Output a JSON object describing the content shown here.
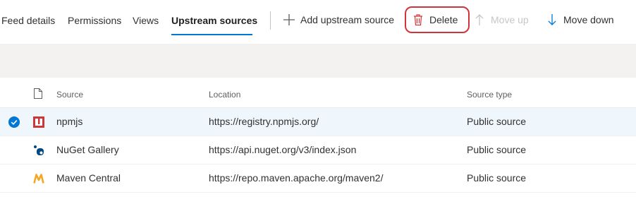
{
  "tabs": [
    {
      "label": "Feed details",
      "active": false
    },
    {
      "label": "Permissions",
      "active": false
    },
    {
      "label": "Views",
      "active": false
    },
    {
      "label": "Upstream sources",
      "active": true
    }
  ],
  "toolbar": {
    "add_label": "Add upstream source",
    "delete_label": "Delete",
    "move_up_label": "Move up",
    "move_up_disabled": true,
    "move_down_label": "Move down"
  },
  "table": {
    "columns": [
      "Source",
      "Location",
      "Source type"
    ],
    "rows": [
      {
        "name": "npmjs",
        "location": "https://registry.npmjs.org/",
        "type": "Public source",
        "icon": "npm-icon",
        "selected": true
      },
      {
        "name": "NuGet Gallery",
        "location": "https://api.nuget.org/v3/index.json",
        "type": "Public source",
        "icon": "nuget-icon",
        "selected": false
      },
      {
        "name": "Maven Central",
        "location": "https://repo.maven.apache.org/maven2/",
        "type": "Public source",
        "icon": "maven-icon",
        "selected": false
      }
    ]
  },
  "colors": {
    "accent": "#0078d4",
    "delete_icon": "#d13438",
    "highlight_outline": "#d13438",
    "selected_row": "#eff6fc",
    "npm_red": "#cb3837",
    "nuget_blue": "#004880",
    "maven_orange": "#f5a623"
  }
}
